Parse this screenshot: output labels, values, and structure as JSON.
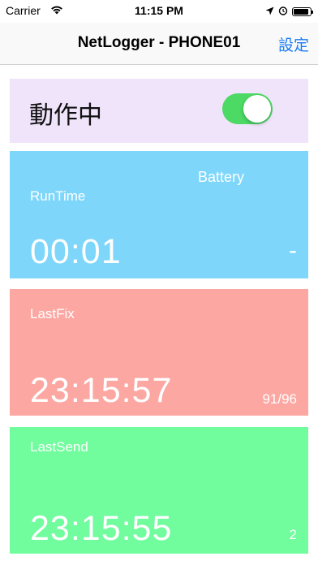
{
  "status_bar": {
    "carrier": "Carrier",
    "time": "11:15 PM",
    "battery_level": 0.9
  },
  "nav": {
    "title": "NetLogger - PHONE01",
    "settings_label": "設定"
  },
  "status_card": {
    "label": "動作中",
    "toggle_on": true,
    "background": "#f0e4fb"
  },
  "runtime_card": {
    "battery_label": "Battery",
    "label": "RunTime",
    "value": "00:01",
    "battery_value": "-",
    "background": "#7ed6fb"
  },
  "lastfix_card": {
    "label": "LastFix",
    "value": "23:15:57",
    "count": "91/96",
    "background": "#fca7a2"
  },
  "lastsend_card": {
    "label": "LastSend",
    "value": "23:15:55",
    "count": "2",
    "background": "#71fc9e"
  },
  "colors": {
    "accent": "#1a7cf5",
    "toggle_on": "#4cd964"
  }
}
